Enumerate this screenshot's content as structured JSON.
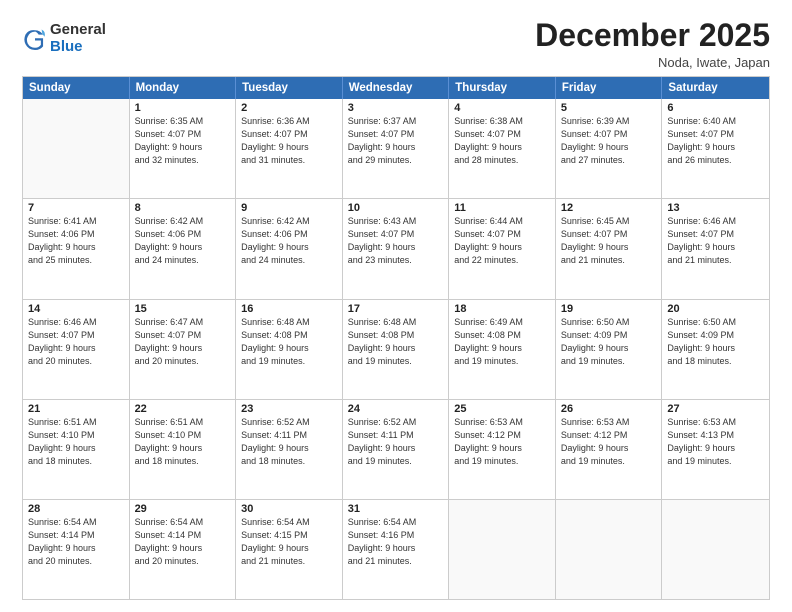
{
  "logo": {
    "general": "General",
    "blue": "Blue"
  },
  "header": {
    "month": "December 2025",
    "location": "Noda, Iwate, Japan"
  },
  "weekdays": [
    "Sunday",
    "Monday",
    "Tuesday",
    "Wednesday",
    "Thursday",
    "Friday",
    "Saturday"
  ],
  "weeks": [
    [
      {
        "day": "",
        "info": ""
      },
      {
        "day": "1",
        "info": "Sunrise: 6:35 AM\nSunset: 4:07 PM\nDaylight: 9 hours\nand 32 minutes."
      },
      {
        "day": "2",
        "info": "Sunrise: 6:36 AM\nSunset: 4:07 PM\nDaylight: 9 hours\nand 31 minutes."
      },
      {
        "day": "3",
        "info": "Sunrise: 6:37 AM\nSunset: 4:07 PM\nDaylight: 9 hours\nand 29 minutes."
      },
      {
        "day": "4",
        "info": "Sunrise: 6:38 AM\nSunset: 4:07 PM\nDaylight: 9 hours\nand 28 minutes."
      },
      {
        "day": "5",
        "info": "Sunrise: 6:39 AM\nSunset: 4:07 PM\nDaylight: 9 hours\nand 27 minutes."
      },
      {
        "day": "6",
        "info": "Sunrise: 6:40 AM\nSunset: 4:07 PM\nDaylight: 9 hours\nand 26 minutes."
      }
    ],
    [
      {
        "day": "7",
        "info": "Sunrise: 6:41 AM\nSunset: 4:06 PM\nDaylight: 9 hours\nand 25 minutes."
      },
      {
        "day": "8",
        "info": "Sunrise: 6:42 AM\nSunset: 4:06 PM\nDaylight: 9 hours\nand 24 minutes."
      },
      {
        "day": "9",
        "info": "Sunrise: 6:42 AM\nSunset: 4:06 PM\nDaylight: 9 hours\nand 24 minutes."
      },
      {
        "day": "10",
        "info": "Sunrise: 6:43 AM\nSunset: 4:07 PM\nDaylight: 9 hours\nand 23 minutes."
      },
      {
        "day": "11",
        "info": "Sunrise: 6:44 AM\nSunset: 4:07 PM\nDaylight: 9 hours\nand 22 minutes."
      },
      {
        "day": "12",
        "info": "Sunrise: 6:45 AM\nSunset: 4:07 PM\nDaylight: 9 hours\nand 21 minutes."
      },
      {
        "day": "13",
        "info": "Sunrise: 6:46 AM\nSunset: 4:07 PM\nDaylight: 9 hours\nand 21 minutes."
      }
    ],
    [
      {
        "day": "14",
        "info": "Sunrise: 6:46 AM\nSunset: 4:07 PM\nDaylight: 9 hours\nand 20 minutes."
      },
      {
        "day": "15",
        "info": "Sunrise: 6:47 AM\nSunset: 4:07 PM\nDaylight: 9 hours\nand 20 minutes."
      },
      {
        "day": "16",
        "info": "Sunrise: 6:48 AM\nSunset: 4:08 PM\nDaylight: 9 hours\nand 19 minutes."
      },
      {
        "day": "17",
        "info": "Sunrise: 6:48 AM\nSunset: 4:08 PM\nDaylight: 9 hours\nand 19 minutes."
      },
      {
        "day": "18",
        "info": "Sunrise: 6:49 AM\nSunset: 4:08 PM\nDaylight: 9 hours\nand 19 minutes."
      },
      {
        "day": "19",
        "info": "Sunrise: 6:50 AM\nSunset: 4:09 PM\nDaylight: 9 hours\nand 19 minutes."
      },
      {
        "day": "20",
        "info": "Sunrise: 6:50 AM\nSunset: 4:09 PM\nDaylight: 9 hours\nand 18 minutes."
      }
    ],
    [
      {
        "day": "21",
        "info": "Sunrise: 6:51 AM\nSunset: 4:10 PM\nDaylight: 9 hours\nand 18 minutes."
      },
      {
        "day": "22",
        "info": "Sunrise: 6:51 AM\nSunset: 4:10 PM\nDaylight: 9 hours\nand 18 minutes."
      },
      {
        "day": "23",
        "info": "Sunrise: 6:52 AM\nSunset: 4:11 PM\nDaylight: 9 hours\nand 18 minutes."
      },
      {
        "day": "24",
        "info": "Sunrise: 6:52 AM\nSunset: 4:11 PM\nDaylight: 9 hours\nand 19 minutes."
      },
      {
        "day": "25",
        "info": "Sunrise: 6:53 AM\nSunset: 4:12 PM\nDaylight: 9 hours\nand 19 minutes."
      },
      {
        "day": "26",
        "info": "Sunrise: 6:53 AM\nSunset: 4:12 PM\nDaylight: 9 hours\nand 19 minutes."
      },
      {
        "day": "27",
        "info": "Sunrise: 6:53 AM\nSunset: 4:13 PM\nDaylight: 9 hours\nand 19 minutes."
      }
    ],
    [
      {
        "day": "28",
        "info": "Sunrise: 6:54 AM\nSunset: 4:14 PM\nDaylight: 9 hours\nand 20 minutes."
      },
      {
        "day": "29",
        "info": "Sunrise: 6:54 AM\nSunset: 4:14 PM\nDaylight: 9 hours\nand 20 minutes."
      },
      {
        "day": "30",
        "info": "Sunrise: 6:54 AM\nSunset: 4:15 PM\nDaylight: 9 hours\nand 21 minutes."
      },
      {
        "day": "31",
        "info": "Sunrise: 6:54 AM\nSunset: 4:16 PM\nDaylight: 9 hours\nand 21 minutes."
      },
      {
        "day": "",
        "info": ""
      },
      {
        "day": "",
        "info": ""
      },
      {
        "day": "",
        "info": ""
      }
    ]
  ]
}
